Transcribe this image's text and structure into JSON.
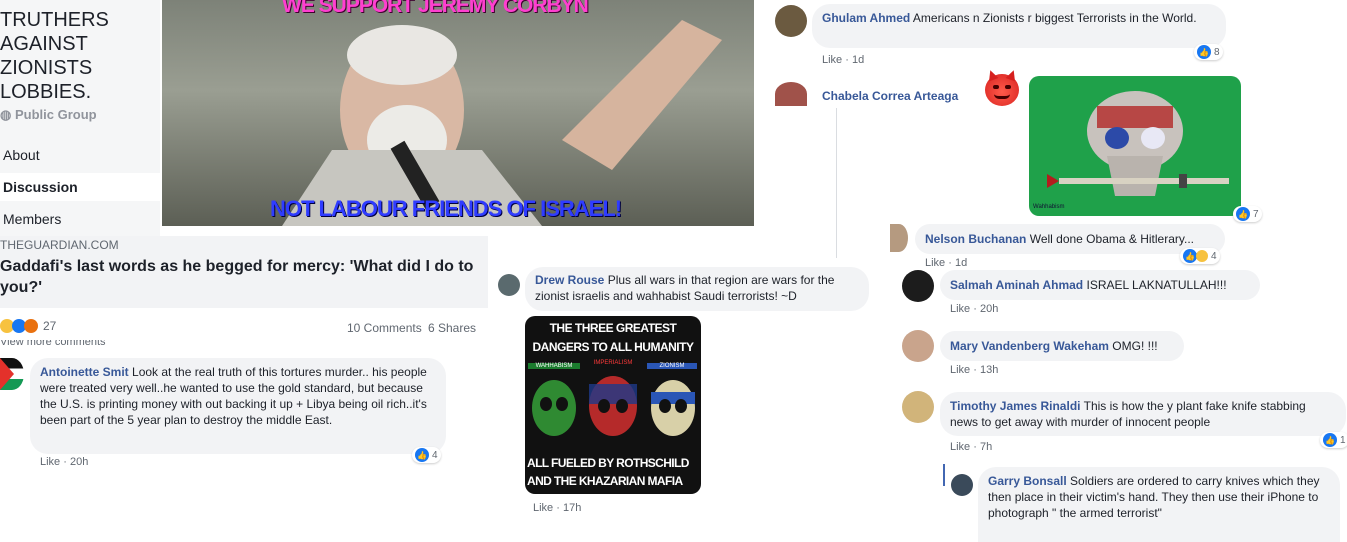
{
  "group": {
    "title_lines": [
      "TRUTHERS",
      "AGAINST",
      "ZIONISTS",
      "LOBBIES."
    ],
    "type": "Public Group",
    "nav": [
      "About",
      "Discussion",
      "Members"
    ]
  },
  "banner": {
    "top_text": "WE SUPPORT JEREMY CORBYN",
    "bottom_text": "NOT LABOUR FRIENDS OF ISRAEL!"
  },
  "post": {
    "source": "THEGUARDIAN.COM",
    "headline": "Gaddafi's last words as he begged for mercy: 'What did I do to you?'",
    "reaction_count": "27",
    "comments": "10 Comments",
    "shares": "6 Shares",
    "more_comments": "View more comments"
  },
  "comments": [
    {
      "name": "Antoinette Smit",
      "text": "Look at the real truth of this tortures murder.. his people were treated very well..he wanted to use the gold standard, but because the U.S. is printing money with out backing it up + Libya being oil rich..it's been part of the 5 year plan to destroy the middle East.",
      "like": "Like",
      "time": "20h",
      "reacts": "4"
    },
    {
      "name": "Drew Rouse",
      "text": "Plus all wars in that region are wars for the zionist israelis and wahhabist Saudi terrorists! ~D",
      "like": "Like",
      "time": "17h"
    },
    {
      "name": "Ghulam Ahmed",
      "text": "Americans n Zionists r biggest Terrorists in the World.",
      "like": "Like",
      "time": "1d",
      "reacts": "8"
    },
    {
      "name": "Chabela Correa Arteaga",
      "reacts": "7"
    },
    {
      "name": "Nelson Buchanan",
      "text": "Well done Obama & Hitlerary...",
      "like": "Like",
      "time": "1d",
      "reacts": "4"
    },
    {
      "name": "Salmah Aminah Ahmad",
      "text": "ISRAEL LAKNATULLAH!!!",
      "like": "Like",
      "time": "20h"
    },
    {
      "name": "Mary Vandenberg Wakeham",
      "text": "OMG! !!!",
      "like": "Like",
      "time": "13h"
    },
    {
      "name": "Timothy James Rinaldi",
      "text": "This is how the y plant fake knife stabbing news to get away with murder of innocent people",
      "like": "Like",
      "time": "7h",
      "reacts": "1"
    },
    {
      "name": "Garry Bonsall",
      "text": "Soldiers are ordered to carry knives which they then place in their victim's hand. They then use their iPhone to photograph \" the armed terrorist\""
    }
  ],
  "poster_image": {
    "title": "THE THREE GREATEST DANGERS TO ALL HUMANITY",
    "labels": [
      "WAHHABISM",
      "IMPERIALISM",
      "ZIONISM"
    ],
    "bottom": "ALL FUELED BY ROTHSCHILD AND THE KHAZARIAN MAFIA"
  },
  "skull_image": {
    "watermark": "Wahhabism"
  },
  "colors": {
    "link": "#385898",
    "bubble": "#f2f3f5",
    "like_blue": "#1877f2",
    "banner_pink": "#ff3fd0",
    "banner_blue": "#2f3cff",
    "skull_bg": "#1fa14a"
  }
}
